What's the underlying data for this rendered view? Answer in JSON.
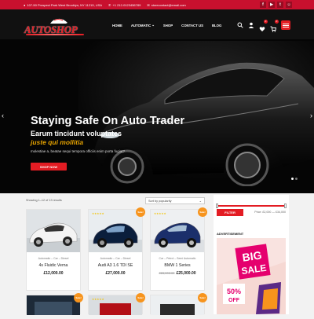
{
  "topbar": {
    "address": "107-50 Prospect Park West Brooklyn, NY 11215, USA",
    "phone": "+1 212-0123456789",
    "email": "storecontact@email.com",
    "socials": [
      "f",
      "▶",
      "t",
      "☺"
    ]
  },
  "brand": {
    "logo_text": "AUTOSHOP"
  },
  "nav": {
    "items": [
      {
        "label": "HOME"
      },
      {
        "label": "AUTOMATIC",
        "caret": "⌄"
      },
      {
        "label": "SHOP"
      },
      {
        "label": "CONTACT US"
      },
      {
        "label": "BLOG"
      }
    ]
  },
  "header_icons": {
    "wishlist_count": "0",
    "cart_count": "0"
  },
  "hero": {
    "title": "Staying Safe On Auto Trader",
    "subtitle": "Earum tincidunt voluptates",
    "tagline": "juste qui mollitia",
    "description": "molestiae a, beatae sequi tempora officiis enim porta fugiat?",
    "button": "SHOP NOW",
    "prev": "‹",
    "next": "›",
    "active_slide": 1,
    "slide_count": 2
  },
  "shop": {
    "results": "Showing 1–12 of 13 results",
    "sort": "Sort by popularity",
    "sort_caret": "⌄",
    "products": [
      {
        "cats": "Automatic – Car – Diesel",
        "name": "4s Fluidic Verna",
        "price": "£12,000.00",
        "old_price": "",
        "stars": "",
        "sale": "",
        "img": "white"
      },
      {
        "cats": "Automatic – Car – Diesel",
        "name": "Audi A3 1.6 TDI SE",
        "price": "£27,000.00",
        "old_price": "",
        "stars": "★★★★★",
        "sale": "Sale!",
        "img": "blue"
      },
      {
        "cats": "Car – Petrol – Semi Automatic",
        "name": "BMW 1 Series",
        "price": "£25,000.00",
        "old_price": "£28,000.00",
        "stars": "★★★★★",
        "sale": "Sale!",
        "img": "navy"
      }
    ],
    "row2_sales": [
      "Sale!",
      "Sale!",
      "Sale!"
    ],
    "row2_stars": [
      "",
      "★★★★★",
      ""
    ]
  },
  "sidebar": {
    "filter_button": "FILTER",
    "price_range": "Price: £2,000 — £34,000",
    "price_min": 2000,
    "price_max": 34000,
    "advert_title": "ADVERTISEMENT",
    "ad": {
      "big": "BIG",
      "sale": "SALE",
      "percent": "50%",
      "off": "OFF"
    }
  },
  "colors": {
    "accent": "#e31c23",
    "topbar": "#c8102e",
    "sale_badge": "#f7941d",
    "stars": "#f3c300"
  }
}
